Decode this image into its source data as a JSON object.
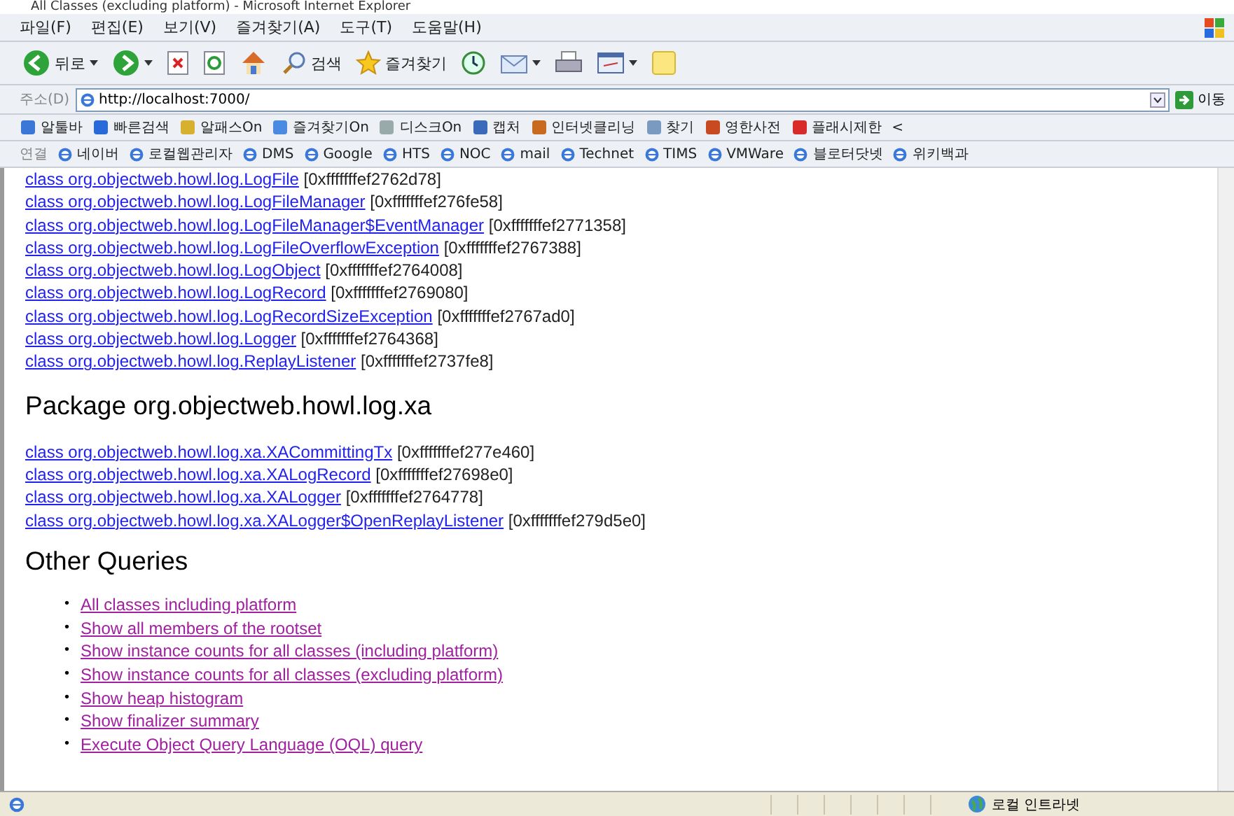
{
  "window": {
    "title": "All Classes (excluding platform) - Microsoft Internet Explorer"
  },
  "menu": [
    "파일(F)",
    "편집(E)",
    "보기(V)",
    "즐겨찾기(A)",
    "도구(T)",
    "도움말(H)"
  ],
  "toolbar": [
    {
      "kind": "back",
      "label": "뒤로",
      "dropdown": true
    },
    {
      "kind": "forward",
      "dropdown": true
    },
    {
      "kind": "stop",
      "dropdown": false
    },
    {
      "kind": "refresh",
      "dropdown": false
    },
    {
      "kind": "home",
      "dropdown": false
    },
    {
      "kind": "search",
      "label": "검색",
      "dropdown": false
    },
    {
      "kind": "favorites",
      "label": "즐겨찾기",
      "dropdown": false
    },
    {
      "kind": "history",
      "dropdown": false
    },
    {
      "kind": "mail",
      "dropdown": true
    },
    {
      "kind": "print",
      "dropdown": false
    },
    {
      "kind": "edit",
      "dropdown": true
    },
    {
      "kind": "note",
      "dropdown": false
    }
  ],
  "address": {
    "label": "주소(D)",
    "value": "http://localhost:7000/",
    "go": "이동"
  },
  "addon_bar": [
    "알툴바",
    "빠른검색",
    "알패스On",
    "즐겨찾기On",
    "디스크On",
    "캡처",
    "인터넷클리닝",
    "찾기",
    "영한사전",
    "플래시제한",
    "<"
  ],
  "links_bar": {
    "label": "연결",
    "items": [
      "네이버",
      "로컬웹관리자",
      "DMS",
      "Google",
      "HTS",
      "NOC",
      "mail",
      "Technet",
      "TIMS",
      "VMWare",
      "블로터닷넷",
      "위키백과"
    ]
  },
  "sections": [
    {
      "classes": [
        {
          "name": "class org.objectweb.howl.log.LogFile",
          "address": "[0xfffffffef2762d78]"
        },
        {
          "name": "class org.objectweb.howl.log.LogFileManager",
          "address": "[0xfffffffef276fe58]"
        },
        {
          "name": "class org.objectweb.howl.log.LogFileManager$EventManager",
          "address": "[0xfffffffef2771358]"
        },
        {
          "name": "class org.objectweb.howl.log.LogFileOverflowException",
          "address": "[0xfffffffef2767388]"
        },
        {
          "name": "class org.objectweb.howl.log.LogObject",
          "address": "[0xfffffffef2764008]"
        },
        {
          "name": "class org.objectweb.howl.log.LogRecord",
          "address": "[0xfffffffef2769080]"
        },
        {
          "name": "class org.objectweb.howl.log.LogRecordSizeException",
          "address": "[0xfffffffef2767ad0]"
        },
        {
          "name": "class org.objectweb.howl.log.Logger",
          "address": "[0xfffffffef2764368]"
        },
        {
          "name": "class org.objectweb.howl.log.ReplayListener",
          "address": "[0xfffffffef2737fe8]"
        }
      ]
    },
    {
      "heading": "Package org.objectweb.howl.log.xa",
      "classes": [
        {
          "name": "class org.objectweb.howl.log.xa.XACommittingTx",
          "address": "[0xfffffffef277e460]"
        },
        {
          "name": "class org.objectweb.howl.log.xa.XALogRecord",
          "address": "[0xfffffffef27698e0]"
        },
        {
          "name": "class org.objectweb.howl.log.xa.XALogger",
          "address": "[0xfffffffef2764778]"
        },
        {
          "name": "class org.objectweb.howl.log.xa.XALogger$OpenReplayListener",
          "address": "[0xfffffffef279d5e0]"
        }
      ]
    }
  ],
  "other_queries": {
    "heading": "Other Queries",
    "bullet": "•",
    "links": [
      "All classes including platform",
      "Show all members of the rootset",
      "Show instance counts for all classes (including platform)",
      "Show instance counts for all classes (excluding platform)",
      "Show heap histogram",
      "Show finalizer summary",
      "Execute Object Query Language (OQL) query"
    ]
  },
  "status_bar": {
    "zone": "로컬 인트라넷"
  }
}
